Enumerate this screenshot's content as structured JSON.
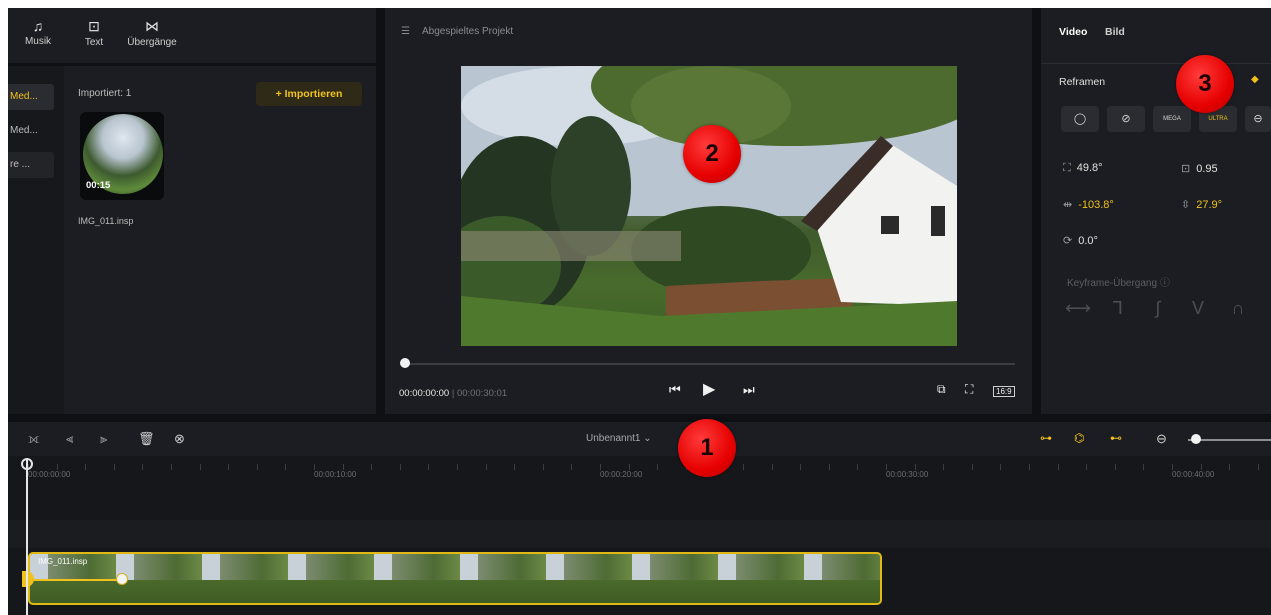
{
  "toolbar": {
    "items": [
      {
        "label": "Musik",
        "icon": "music-icon"
      },
      {
        "label": "Text",
        "icon": "text-icon"
      },
      {
        "label": "Übergänge",
        "icon": "transition-icon"
      }
    ]
  },
  "media": {
    "sidebar": [
      "Med...",
      "Med...",
      "re ..."
    ],
    "imported_label": "Importiert: 1",
    "import_button": "+ Importieren",
    "file": {
      "duration": "00:15",
      "name": "IMG_011.insp"
    }
  },
  "preview": {
    "title": "Abgespieltes Projekt",
    "time_current": "00:00:00:00",
    "time_sep": "|",
    "time_total": "00:00:30:01",
    "aspect_label": "16:9"
  },
  "inspector": {
    "tabs": [
      "Video",
      "Bild"
    ],
    "reframe_label": "Reframen",
    "options": [
      "◯",
      "⊘",
      "MEGA",
      "ULTRA",
      "⊖"
    ],
    "params": {
      "fov": "49.8°",
      "distortion": "0.95",
      "pan": "-103.8°",
      "tilt": "27.9°",
      "roll": "0.0°"
    },
    "keyframe_title": "Keyframe-Übergang ⓘ"
  },
  "timeline": {
    "project_name": "Unbenannt1",
    "ruler": [
      "00:00:00:00",
      "00:00:10:00",
      "00:00:20:00",
      "00:00:30:00",
      "00:00:40:00"
    ],
    "clip_label": "IMG_011.insp"
  },
  "markers": [
    "1",
    "2",
    "3"
  ],
  "colors": {
    "accent": "#f1c21b",
    "marker": "#e60000",
    "background": "#0e1014",
    "panel": "#1b1d22"
  }
}
